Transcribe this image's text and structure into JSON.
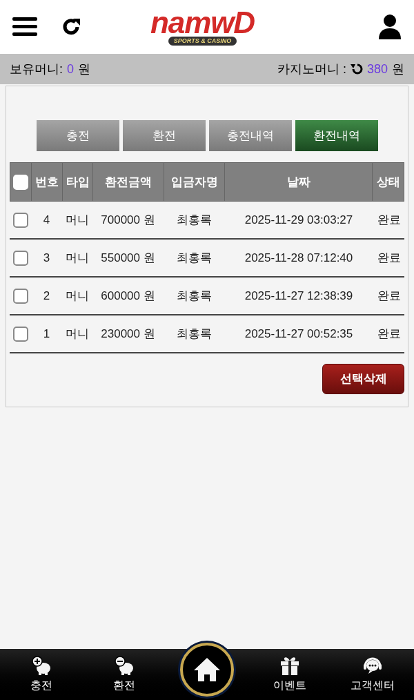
{
  "header": {
    "logo": {
      "wordmark": "namwD",
      "tagline": "SPORTS & CASINO"
    }
  },
  "balance": {
    "label": "보유머니:",
    "amount": "0",
    "unit": "원",
    "casino_label": "카지노머니 :",
    "casino_amount": "380",
    "casino_unit": "원"
  },
  "tabs": [
    {
      "label": "충전",
      "selected": false
    },
    {
      "label": "환전",
      "selected": false
    },
    {
      "label": "충전내역",
      "selected": false
    },
    {
      "label": "환전내역",
      "selected": true
    }
  ],
  "table": {
    "select_all_checked": false,
    "columns": [
      "번호",
      "타입",
      "환전금액",
      "입금자명",
      "날짜",
      "상태"
    ],
    "rows": [
      {
        "checked": false,
        "cells": [
          "4",
          "머니",
          "700000 원",
          "최홍록",
          "2025-11-29 03:03:27",
          "완료"
        ]
      },
      {
        "checked": false,
        "cells": [
          "3",
          "머니",
          "550000 원",
          "최홍록",
          "2025-11-28 07:12:40",
          "완료"
        ]
      },
      {
        "checked": false,
        "cells": [
          "2",
          "머니",
          "600000 원",
          "최홍록",
          "2025-11-27 12:38:39",
          "완료"
        ]
      },
      {
        "checked": false,
        "cells": [
          "1",
          "머니",
          "230000 원",
          "최홍록",
          "2025-11-27 00:52:35",
          "완료"
        ]
      }
    ]
  },
  "delete_button": "선택삭제",
  "bottom_nav": [
    {
      "kind": "deposit",
      "label": "충전"
    },
    {
      "kind": "withdraw",
      "label": "환전"
    },
    {
      "kind": "home"
    },
    {
      "kind": "event",
      "label": "이벤트"
    },
    {
      "kind": "support",
      "label": "고객센터"
    }
  ]
}
